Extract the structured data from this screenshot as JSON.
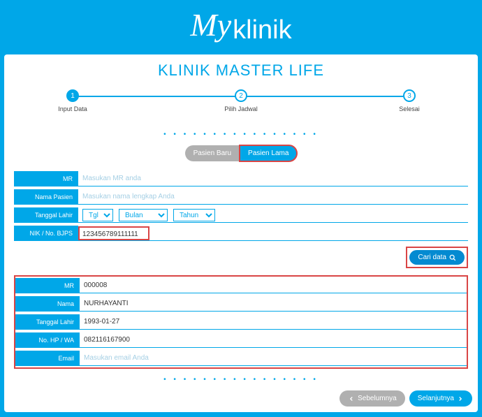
{
  "brand": {
    "part1": "My",
    "part2": "klinik"
  },
  "clinic_title": "KLINIK MASTER LIFE",
  "stepper": {
    "steps": [
      {
        "num": "1",
        "label": "Input Data",
        "active": true
      },
      {
        "num": "2",
        "label": "Pilih Jadwal",
        "active": false
      },
      {
        "num": "3",
        "label": "Selesai",
        "active": false
      }
    ]
  },
  "segment": {
    "baru": "Pasien Baru",
    "lama": "Pasien Lama"
  },
  "search_form": {
    "mr": {
      "label": "MR",
      "placeholder": "Masukan MR anda",
      "value": ""
    },
    "nama": {
      "label": "Nama Pasien",
      "placeholder": "Masukan nama lengkap Anda",
      "value": ""
    },
    "tgl_lahir": {
      "label": "Tanggal Lahir",
      "tgl_placeholder": "Tgl",
      "bulan_placeholder": "Bulan",
      "tahun_placeholder": "Tahun"
    },
    "nik": {
      "label": "NIK / No. BJPS",
      "value": "123456789111111"
    },
    "cari_label": "Cari data"
  },
  "result": {
    "mr": {
      "label": "MR",
      "value": "000008"
    },
    "nama": {
      "label": "Nama",
      "value": "NURHAYANTI"
    },
    "tgl_lahir": {
      "label": "Tanggal Lahir",
      "value": "1993-01-27"
    },
    "hp": {
      "label": "No. HP / WA",
      "value": "082116167900"
    },
    "email": {
      "label": "Email",
      "placeholder": "Masukan email Anda",
      "value": ""
    }
  },
  "nav": {
    "prev": "Sebelumnya",
    "next": "Selanjutnya"
  }
}
